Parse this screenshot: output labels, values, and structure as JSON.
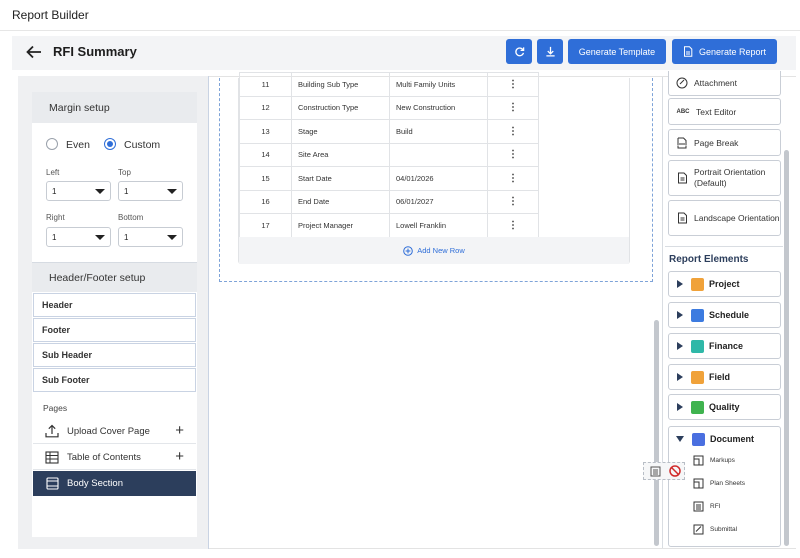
{
  "app": {
    "title": "Report Builder"
  },
  "header": {
    "page_title": "RFI Summary",
    "generate_template_label": "Generate Template",
    "generate_report_label": "Generate Report",
    "accent": "#2f6ed8"
  },
  "margin": {
    "title": "Margin setup",
    "even_label": "Even",
    "custom_label": "Custom",
    "selected": "Custom",
    "left_label": "Left",
    "left_value": "1",
    "top_label": "Top",
    "top_value": "1",
    "right_label": "Right",
    "right_value": "1",
    "bottom_label": "Bottom",
    "bottom_value": "1"
  },
  "headerfooter": {
    "title": "Header/Footer setup",
    "items": [
      "Header",
      "Footer",
      "Sub Header",
      "Sub Footer"
    ]
  },
  "pages": {
    "label": "Pages",
    "items": [
      {
        "label": "Upload Cover Page",
        "icon": "upload-icon"
      },
      {
        "label": "Table of Contents",
        "icon": "table-icon"
      },
      {
        "label": "Body Section",
        "icon": "document-icon",
        "active": true
      }
    ]
  },
  "table": {
    "rows": [
      {
        "num": "11",
        "field": "Building Sub Type",
        "value": "Multi Family Units"
      },
      {
        "num": "12",
        "field": "Construction Type",
        "value": "New Construction"
      },
      {
        "num": "13",
        "field": "Stage",
        "value": "Build"
      },
      {
        "num": "14",
        "field": "Site Area",
        "value": ""
      },
      {
        "num": "15",
        "field": "Start Date",
        "value": "04/01/2026"
      },
      {
        "num": "16",
        "field": "End Date",
        "value": "06/01/2027"
      },
      {
        "num": "17",
        "field": "Project Manager",
        "value": "Lowell Franklin"
      }
    ],
    "menu_glyph": "⋮",
    "add_row_label": "Add New Row"
  },
  "tools": {
    "items": [
      "Attachment",
      "Text Editor",
      "Page Break",
      "Portrait Orientation (Default)",
      "Landscape Orientation"
    ]
  },
  "report_elements": {
    "title": "Report Elements",
    "categories": [
      {
        "label": "Project",
        "color": "#f0a23a"
      },
      {
        "label": "Schedule",
        "color": "#3c7be0"
      },
      {
        "label": "Finance",
        "color": "#2fb8a8"
      },
      {
        "label": "Field",
        "color": "#f0a23a"
      },
      {
        "label": "Quality",
        "color": "#3fb34f"
      },
      {
        "label": "Document",
        "color": "#4a6fe0"
      }
    ],
    "document_items": [
      "Markups",
      "Plan Sheets",
      "RFI",
      "Submittal"
    ]
  }
}
